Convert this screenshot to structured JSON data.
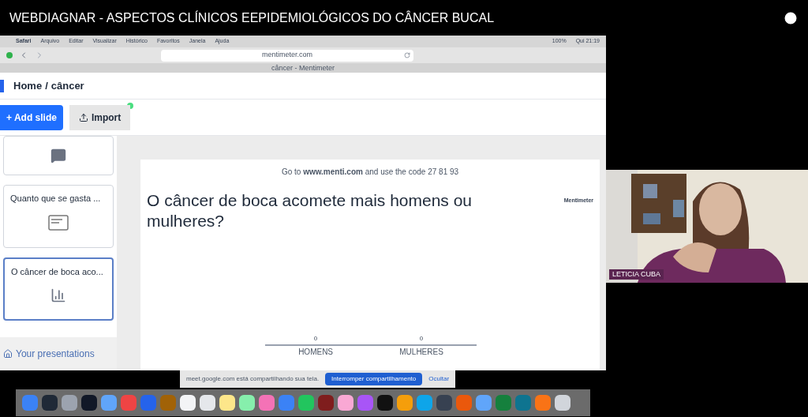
{
  "video_title": "WEBDIAGNAR - ASPECTOS CLÍNICOS EEPIDEMIOLÓGICOS DO CÂNCER BUCAL",
  "menubar": {
    "app": "Safari",
    "items": [
      "Arquivo",
      "Editar",
      "Visualizar",
      "Histórico",
      "Favoritos",
      "Janela",
      "Ajuda"
    ],
    "battery": "100%",
    "clock": "Qui 21:19"
  },
  "browser": {
    "url": "mentimeter.com",
    "tab_title": "câncer - Mentimeter"
  },
  "breadcrumb": [
    "Home",
    "/",
    "câncer"
  ],
  "toolbar": {
    "add_slide": "+ Add slide",
    "import": "Import"
  },
  "slides": [
    {
      "kind": "comments",
      "selected": false
    },
    {
      "kind": "text",
      "title": "Quanto que se gasta ...",
      "selected": false
    },
    {
      "kind": "bars",
      "title": "O câncer de boca aco...",
      "selected": true
    }
  ],
  "your_presentations": "Your presentations",
  "slide": {
    "instruction": "Go to **www.menti.com** and use the code 27 81 93",
    "brand": "Mentimeter",
    "question": "O câncer de boca acomete mais homens ou mulheres?",
    "bars": [
      {
        "label": "HOMENS",
        "value": "0"
      },
      {
        "label": "MULHERES",
        "value": "0"
      }
    ]
  },
  "share_notice": {
    "text": "meet.google.com está compartilhando sua tela.",
    "stop": "Interromper compartilhamento",
    "hide": "Ocultar"
  },
  "participant": {
    "name": "LETICIA CUBA",
    "kind": "picture"
  }
}
